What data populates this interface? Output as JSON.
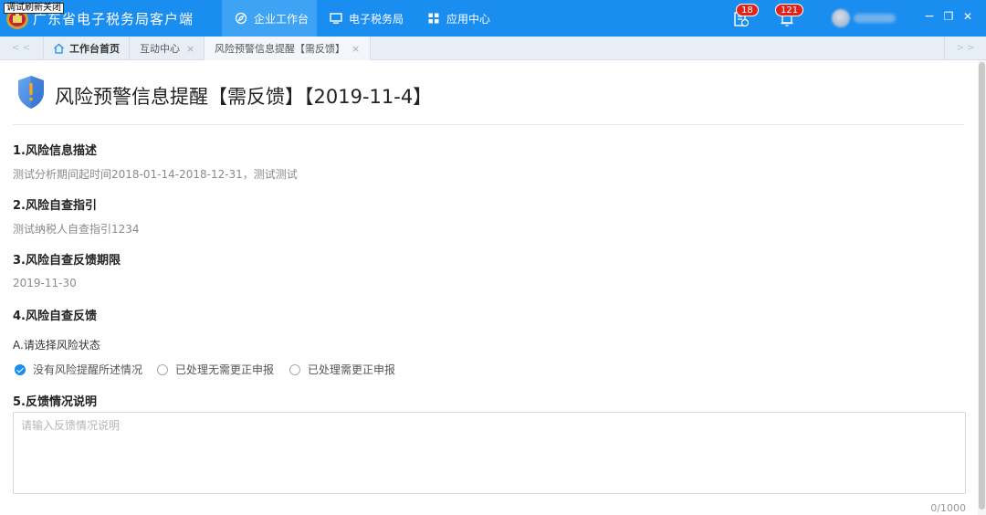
{
  "debug_tag": "调试刷新关闭",
  "app": {
    "title": "广东省电子税务局客户端"
  },
  "nav": {
    "tabs": [
      {
        "label": "企业工作台",
        "icon": "compass-icon",
        "active": true
      },
      {
        "label": "电子税务局",
        "icon": "monitor-icon",
        "active": false
      },
      {
        "label": "应用中心",
        "icon": "grid-icon",
        "active": false
      }
    ],
    "task_badge": "18",
    "notification_badge": "121"
  },
  "tabstrip": {
    "scroll_left": "< <",
    "scroll_right": "> >",
    "tabs": [
      {
        "label": "工作台首页",
        "closable": false
      },
      {
        "label": "互动中心",
        "closable": true
      },
      {
        "label": "风险预警信息提醒【需反馈】",
        "closable": true,
        "current": true
      }
    ],
    "close_glyph": "×"
  },
  "page": {
    "title": "风险预警信息提醒【需反馈】【2019-11-4】",
    "sections": [
      {
        "heading": "1.风险信息描述",
        "text": "测试分析期间起时间2018-01-14-2018-12-31，测试测试"
      },
      {
        "heading": "2.风险自查指引",
        "text": "测试纳税人自查指引1234"
      },
      {
        "heading": "3.风险自查反馈期限",
        "text": "2019-11-30"
      },
      {
        "heading": "4.风险自查反馈",
        "text": ""
      }
    ],
    "status_label": "A.请选择风险状态",
    "radio_options": [
      {
        "label": "没有风险提醒所述情况",
        "checked": true
      },
      {
        "label": "已处理无需更正申报",
        "checked": false
      },
      {
        "label": "已处理需更正申报",
        "checked": false
      }
    ],
    "feedback": {
      "heading": "5.反馈情况说明",
      "placeholder": "请输入反馈情况说明",
      "value": "",
      "counter": "0/1000"
    }
  },
  "colors": {
    "primary": "#1a8df0",
    "badge": "#e0241b",
    "tab_active": "#3ea2f5",
    "shield": "#4a90e2"
  },
  "window_controls": {
    "minimize": "−",
    "restore": "❐",
    "close": "✕"
  }
}
